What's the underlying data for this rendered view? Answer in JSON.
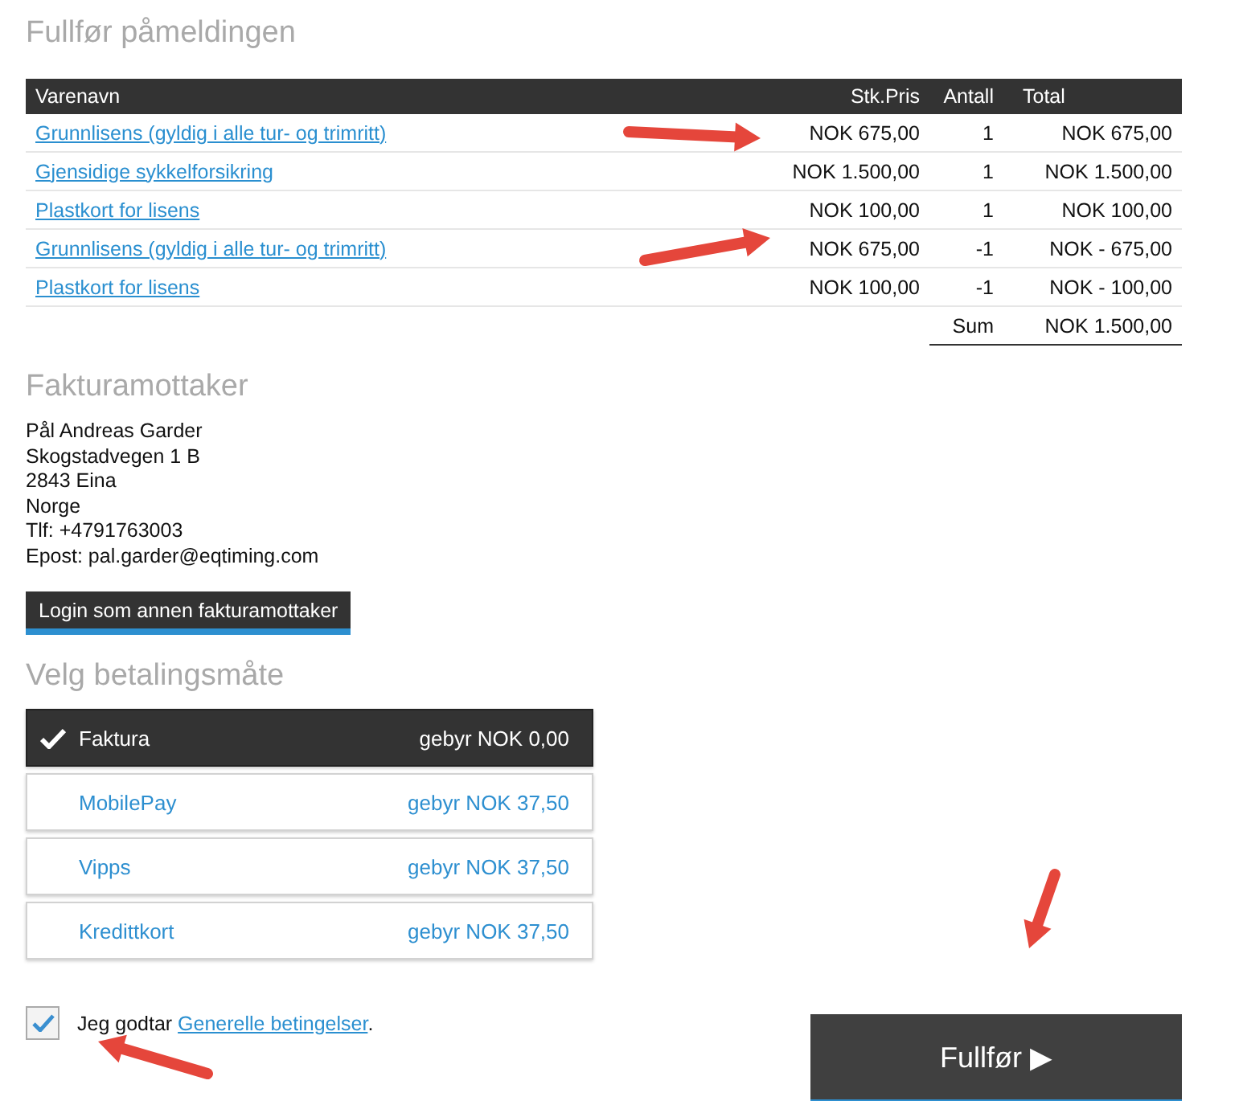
{
  "title": "Fullfør påmeldingen",
  "table": {
    "columns": [
      "Varenavn",
      "Stk.Pris",
      "Antall",
      "Total"
    ],
    "rows": [
      {
        "name": "Grunnlisens (gyldig i alle tur- og trimritt)",
        "price": "NOK 675,00",
        "qty": "1",
        "total": "NOK 675,00"
      },
      {
        "name": "Gjensidige sykkelforsikring",
        "price": "NOK 1.500,00",
        "qty": "1",
        "total": "NOK 1.500,00"
      },
      {
        "name": "Plastkort for lisens",
        "price": "NOK 100,00",
        "qty": "1",
        "total": "NOK 100,00"
      },
      {
        "name": "Grunnlisens (gyldig i alle tur- og trimritt)",
        "price": "NOK 675,00",
        "qty": "-1",
        "total": "NOK - 675,00"
      },
      {
        "name": "Plastkort for lisens",
        "price": "NOK 100,00",
        "qty": "-1",
        "total": "NOK - 100,00"
      }
    ],
    "sum_label": "Sum",
    "sum_value": "NOK 1.500,00"
  },
  "invoice": {
    "heading": "Fakturamottaker",
    "lines": [
      "Pål Andreas Garder",
      "Skogstadvegen 1 B",
      "2843 Eina",
      "Norge",
      "Tlf: +4791763003",
      "Epost: pal.garder@eqtiming.com"
    ],
    "button": "Login som annen fakturamottaker"
  },
  "payment": {
    "heading": "Velg betalingsmåte",
    "options": [
      {
        "label": "Faktura",
        "fee": "gebyr NOK 0,00",
        "selected": true
      },
      {
        "label": "MobilePay",
        "fee": "gebyr NOK 37,50",
        "selected": false
      },
      {
        "label": "Vipps",
        "fee": "gebyr NOK 37,50",
        "selected": false
      },
      {
        "label": "Kredittkort",
        "fee": "gebyr NOK 37,50",
        "selected": false
      }
    ]
  },
  "terms": {
    "checked": true,
    "text": "Jeg godtar ",
    "link": "Generelle betingelser",
    "after": "."
  },
  "submit": "Fullfør ▶"
}
